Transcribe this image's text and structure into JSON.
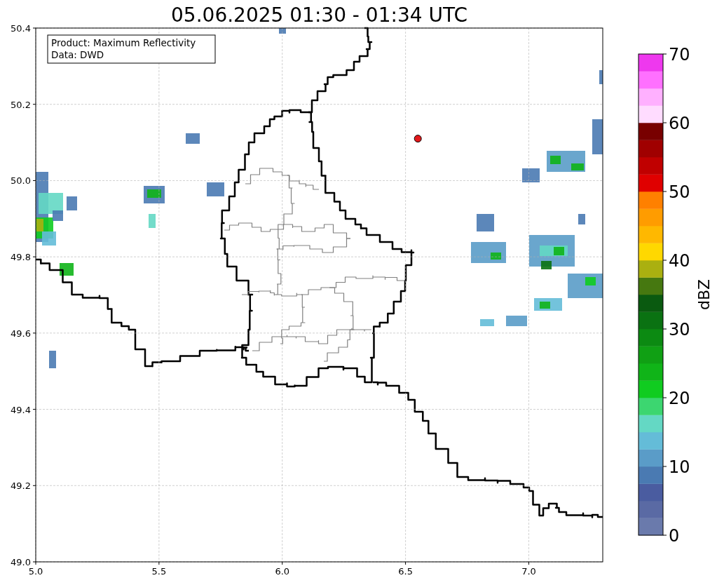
{
  "title": "05.06.2025 01:30 - 01:34 UTC",
  "info_box": {
    "lines": [
      "Product: Maximum Reflectivity",
      "Data: DWD"
    ]
  },
  "map": {
    "chart_data": {
      "type": "scatter",
      "xlim": [
        5.0,
        7.3
      ],
      "ylim": [
        49.0,
        50.4
      ],
      "xticks": [
        {
          "value": 5.0,
          "label": "5.0"
        },
        {
          "value": 5.5,
          "label": "5.5"
        },
        {
          "value": 6.0,
          "label": "6.0"
        },
        {
          "value": 6.5,
          "label": "6.5"
        },
        {
          "value": 7.0,
          "label": "7.0"
        }
      ],
      "yticks": [
        {
          "value": 49.0,
          "label": "49.0"
        },
        {
          "value": 49.2,
          "label": "49.2"
        },
        {
          "value": 49.4,
          "label": "49.4"
        },
        {
          "value": 49.6,
          "label": "49.6"
        },
        {
          "value": 49.8,
          "label": "49.8"
        },
        {
          "value": 50.0,
          "label": "50.0"
        },
        {
          "value": 50.2,
          "label": "50.2"
        },
        {
          "value": 50.4,
          "label": "50.4"
        }
      ],
      "grid": true,
      "series": [
        {
          "color": "#e31a1c",
          "x": [
            6.55
          ],
          "values": [
            50.11
          ]
        }
      ]
    }
  },
  "colorbar": {
    "label": "dBZ",
    "ticks": [
      "70",
      "60",
      "50",
      "40",
      "30",
      "20",
      "10",
      "0"
    ],
    "segments": [
      {
        "color": "#6a7aac"
      },
      {
        "color": "#5a6aa4"
      },
      {
        "color": "#4a5ca0"
      },
      {
        "color": "#4a7ab2"
      },
      {
        "color": "#5a9cc8"
      },
      {
        "color": "#64bcd8"
      },
      {
        "color": "#64d8c4"
      },
      {
        "color": "#3cd670"
      },
      {
        "color": "#10cc20"
      },
      {
        "color": "#10b418"
      },
      {
        "color": "#10a014"
      },
      {
        "color": "#0c8a12"
      },
      {
        "color": "#0a7212"
      },
      {
        "color": "#0a5a10"
      },
      {
        "color": "#467810"
      },
      {
        "color": "#aab010"
      },
      {
        "color": "#ffd800"
      },
      {
        "color": "#ffb800"
      },
      {
        "color": "#ff9c00"
      },
      {
        "color": "#ff8000"
      },
      {
        "color": "#e00000"
      },
      {
        "color": "#c00000"
      },
      {
        "color": "#a00000"
      },
      {
        "color": "#780000"
      },
      {
        "color": "#ffdcff"
      },
      {
        "color": "#ffb0ff"
      },
      {
        "color": "#ff70ff"
      },
      {
        "color": "#ee38ee"
      }
    ]
  }
}
